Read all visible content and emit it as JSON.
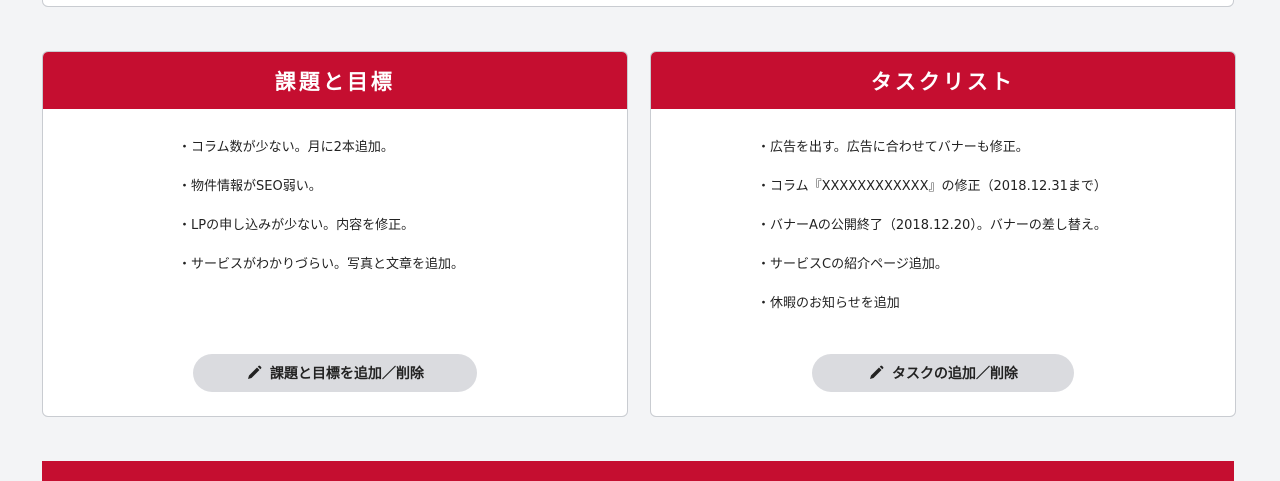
{
  "colors": {
    "accent": "#c50e30",
    "background": "#f3f4f6",
    "button": "#dadbdf"
  },
  "issues_card": {
    "title": "課題と目標",
    "items": [
      "・コラム数が少ない。月に2本追加。",
      "・物件情報がSEO弱い。",
      "・LPの申し込みが少ない。内容を修正。",
      "・サービスがわかりづらい。写真と文章を追加。"
    ],
    "button_icon": "pencil-icon",
    "button_label": "課題と目標を追加／削除"
  },
  "task_card": {
    "title": "タスクリスト",
    "items": [
      "・広告を出す。広告に合わせてバナーも修正。",
      "・コラム『XXXXXXXXXXXX』の修正（2018.12.31まで）",
      "・バナーAの公開終了（2018.12.20）。バナーの差し替え。",
      "・サービスCの紹介ページ追加。",
      "・休暇のお知らせを追加"
    ],
    "button_icon": "pencil-icon",
    "button_label": "タスクの追加／削除"
  }
}
